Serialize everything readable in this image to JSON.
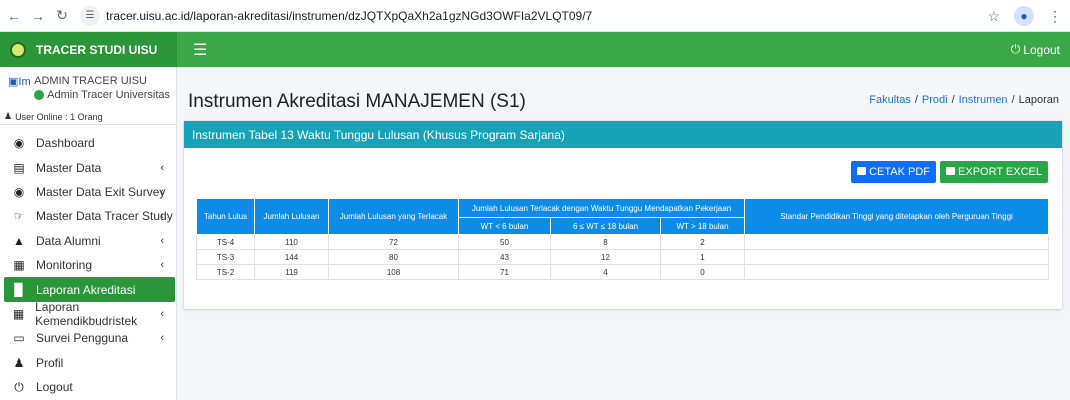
{
  "browser": {
    "url": "tracer.uisu.ac.id/laporan-akreditasi/instrumen/dzJQTXpQaXh2a1gzNGd3OWFIa2VLQT09/7"
  },
  "app": {
    "brand": "TRACER STUDI UISU",
    "logout_label": "Logout"
  },
  "user": {
    "image_alt": "Image",
    "name": "ADMIN TRACER UISU",
    "role": "Admin Tracer Universitas",
    "online": "User Online : 1 Orang"
  },
  "sidebar": {
    "items": [
      {
        "label": "Dashboard",
        "icon": "tachometer-icon",
        "has_chevron": false,
        "active": false
      },
      {
        "label": "Master Data",
        "icon": "database-icon",
        "has_chevron": true,
        "active": false
      },
      {
        "label": "Master Data Exit Survey",
        "icon": "eye-icon",
        "has_chevron": true,
        "active": false
      },
      {
        "label": "Master Data Tracer Study",
        "icon": "handshake-icon",
        "has_chevron": true,
        "active": false
      },
      {
        "label": "Data Alumni",
        "icon": "graduation-cap-icon",
        "has_chevron": true,
        "active": false
      },
      {
        "label": "Monitoring",
        "icon": "list-alt-icon",
        "has_chevron": true,
        "active": false
      },
      {
        "label": "Laporan Akreditasi",
        "icon": "chart-bar-icon",
        "has_chevron": false,
        "active": true
      },
      {
        "label": "Laporan Kemendikbudristek",
        "icon": "building-icon",
        "has_chevron": true,
        "active": false
      },
      {
        "label": "Survei Pengguna",
        "icon": "laptop-icon",
        "has_chevron": true,
        "active": false
      },
      {
        "label": "Profil",
        "icon": "user-icon",
        "has_chevron": false,
        "active": false
      },
      {
        "label": "Logout",
        "icon": "power-icon",
        "has_chevron": false,
        "active": false
      }
    ]
  },
  "page": {
    "title": "Instrumen Akreditasi MANAJEMEN (S1)",
    "breadcrumb": [
      "Fakultas",
      "Prodi",
      "Instrumen",
      "Laporan"
    ]
  },
  "card": {
    "title": "Instrumen Tabel 13 Waktu Tunggu Lulusan (Khusus Program Sarjana)",
    "pdf_label": "CETAK PDF",
    "excel_label": "EXPORT EXCEL"
  },
  "table": {
    "col_tahun": "Tahun Lulus",
    "col_jumlah": "Jumlah Lulusan",
    "col_terlacak": "Jumlah Lulusan yang Terlacak",
    "col_group": "Jumlah Lulusan Terlacak dengan Waktu Tunggu Mendapatkan Pekerjaan",
    "col_standar": "Standar Pendidikan Tinggi yang ditetapkan oleh Perguruan Tinggi",
    "sub_cols": [
      "WT < 6 bulan",
      "6 ≤ WT ≤ 18 bulan",
      "WT > 18 bulan"
    ],
    "rows": [
      [
        "TS-4",
        "110",
        "72",
        "50",
        "8",
        "2",
        ""
      ],
      [
        "TS-3",
        "144",
        "80",
        "43",
        "12",
        "1",
        ""
      ],
      [
        "TS-2",
        "119",
        "108",
        "71",
        "4",
        "0",
        ""
      ]
    ]
  },
  "colors": {
    "brand_green": "#2a9638",
    "navbar_green": "#3aa847",
    "card_header": "#17a2b8",
    "table_header": "#0d8be9",
    "pdf_button": "#0d6efd",
    "excel_button": "#28a745"
  }
}
